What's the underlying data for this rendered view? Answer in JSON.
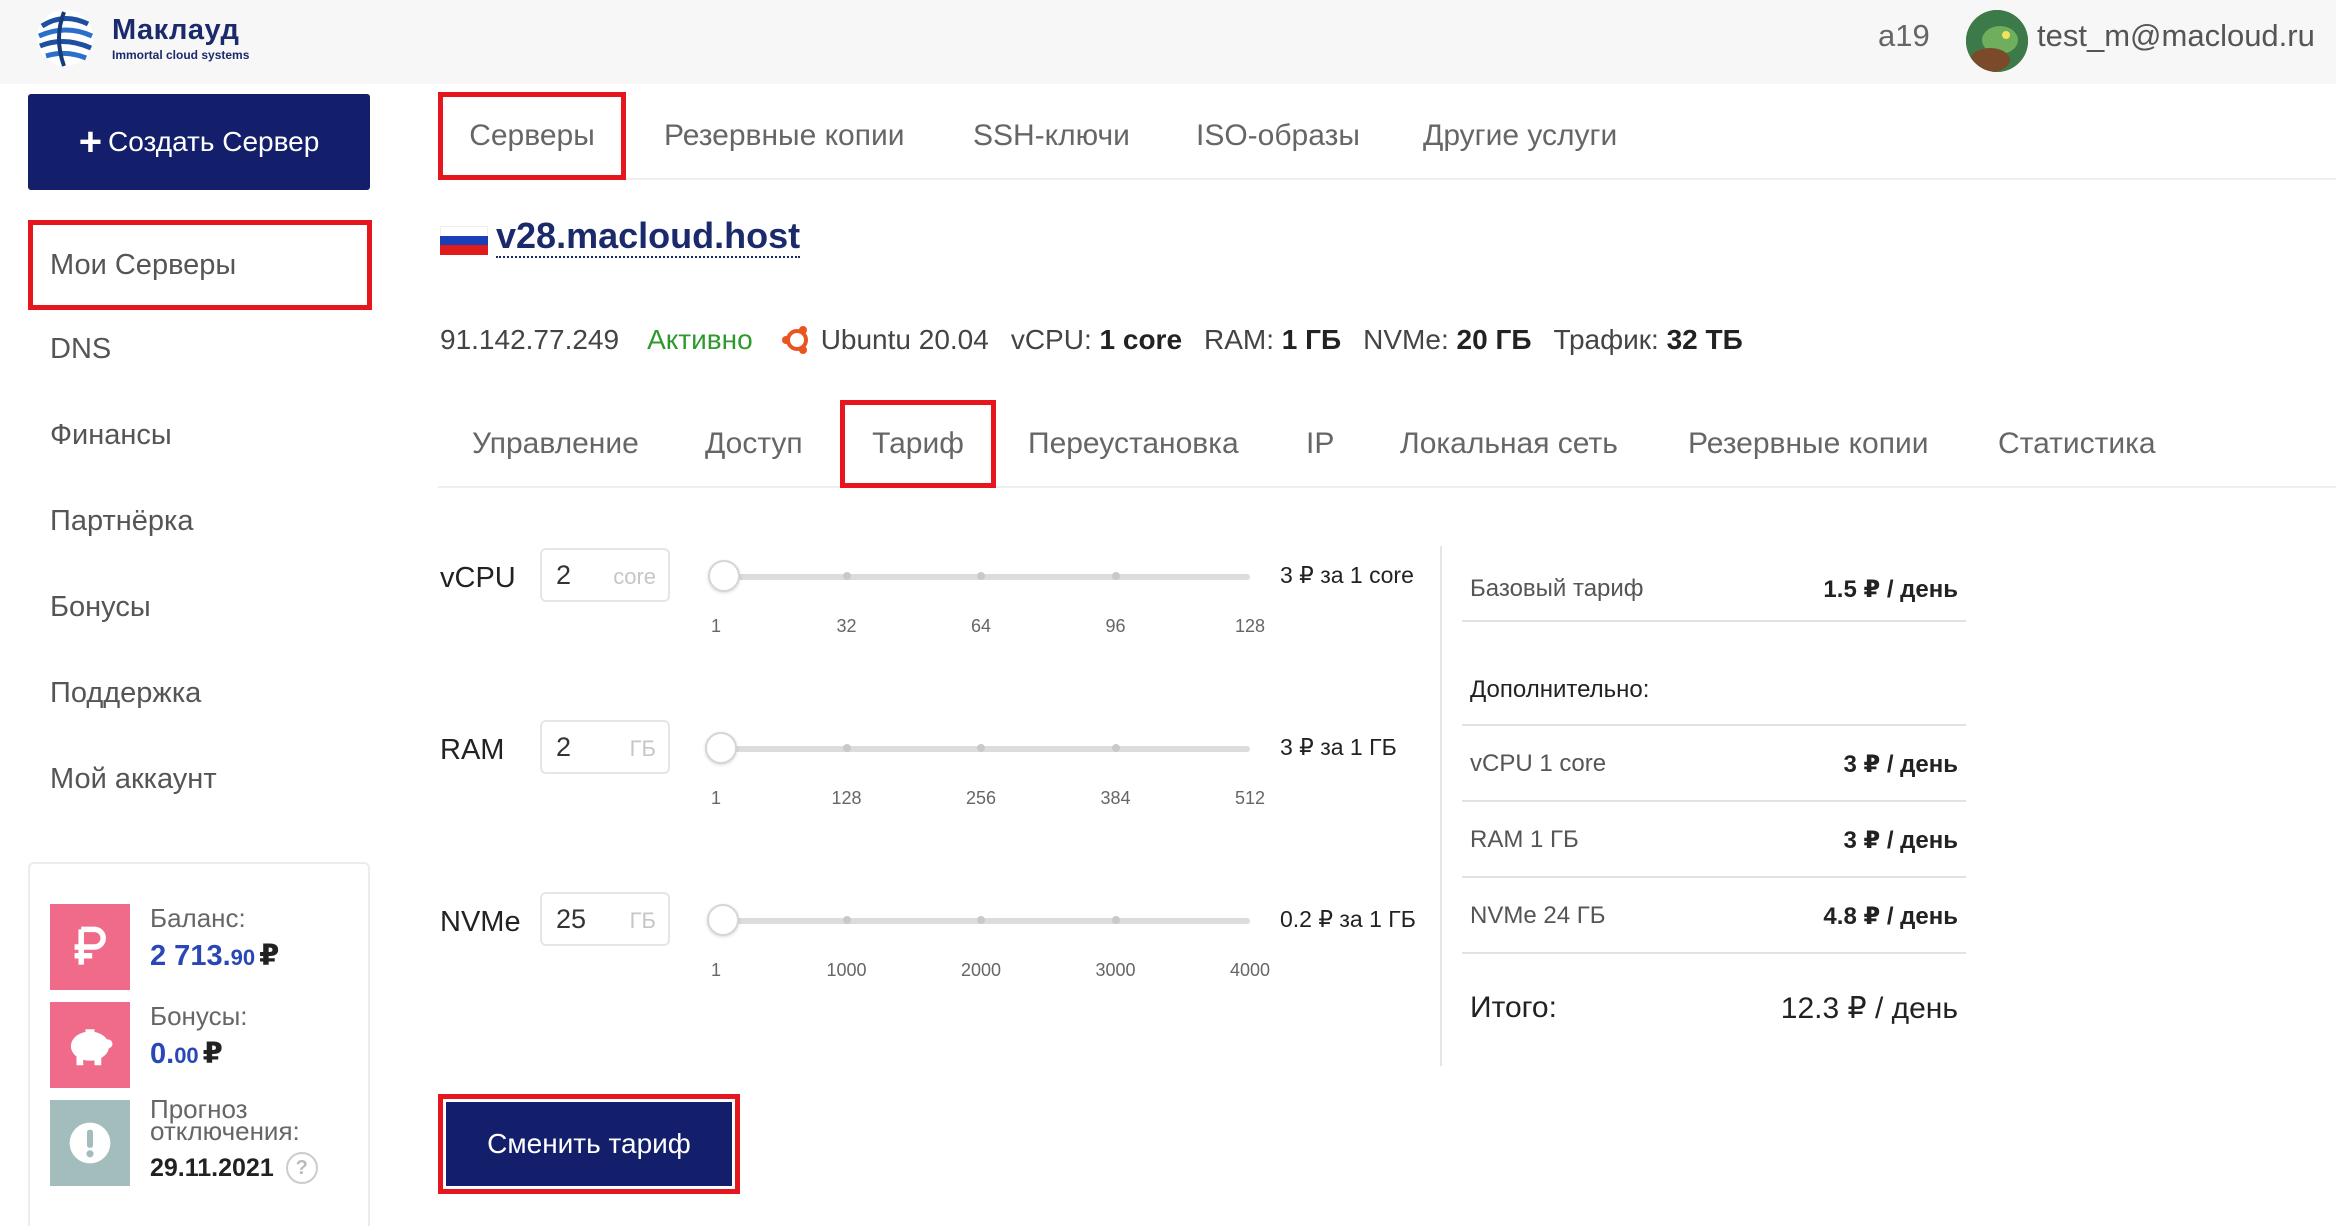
{
  "brand": {
    "name": "Маклауд",
    "tagline": "Immortal cloud systems"
  },
  "header": {
    "account_id": "a19",
    "user_email": "test_m@macloud.ru"
  },
  "sidebar": {
    "create_button": "Создать Сервер",
    "items": [
      {
        "label": "Мои Серверы"
      },
      {
        "label": "DNS"
      },
      {
        "label": "Финансы"
      },
      {
        "label": "Партнёрка"
      },
      {
        "label": "Бонусы"
      },
      {
        "label": "Поддержка"
      },
      {
        "label": "Мой аккаунт"
      }
    ]
  },
  "balance": {
    "balance_label": "Баланс:",
    "balance_int": "2 713.",
    "balance_dec": "90",
    "bonus_label": "Бонусы:",
    "bonus_int": "0.",
    "bonus_dec": "00",
    "currency": "₽",
    "forecast_label_1": "Прогноз",
    "forecast_label_2": "отключения:",
    "forecast_date": "29.11.2021",
    "help": "?"
  },
  "top_tabs": [
    {
      "label": "Серверы"
    },
    {
      "label": "Резервные копии"
    },
    {
      "label": "SSH-ключи"
    },
    {
      "label": "ISO-образы"
    },
    {
      "label": "Другие услуги"
    }
  ],
  "server": {
    "host": "v28.macloud.host",
    "ip": "91.142.77.249",
    "status": "Активно",
    "os": "Ubuntu 20.04",
    "vcpu_label": "vCPU:",
    "vcpu_value": "1 core",
    "ram_label": "RAM:",
    "ram_value": "1 ГБ",
    "nvme_label": "NVMe:",
    "nvme_value": "20 ГБ",
    "traffic_label": "Трафик:",
    "traffic_value": "32 ТБ",
    "status_color": "#2e9a2e"
  },
  "sub_tabs": [
    {
      "label": "Управление"
    },
    {
      "label": "Доступ"
    },
    {
      "label": "Тариф"
    },
    {
      "label": "Переустановка"
    },
    {
      "label": "IP"
    },
    {
      "label": "Локальная сеть"
    },
    {
      "label": "Резервные копии"
    },
    {
      "label": "Статистика"
    }
  ],
  "tariff": {
    "vcpu": {
      "label": "vCPU",
      "value": "2",
      "unit": "core",
      "min": 1,
      "max": 128,
      "current": 2,
      "ticks": [
        "1",
        "32",
        "64",
        "96",
        "128"
      ],
      "price": "3 ₽ за 1 core"
    },
    "ram": {
      "label": "RAM",
      "value": "2",
      "unit": "ГБ",
      "min": 1,
      "max": 512,
      "current": 2,
      "ticks": [
        "1",
        "128",
        "256",
        "384",
        "512"
      ],
      "price": "3 ₽ за 1 ГБ"
    },
    "nvme": {
      "label": "NVMe",
      "value": "25",
      "unit": "ГБ",
      "min": 1,
      "max": 4000,
      "current": 25,
      "ticks": [
        "1",
        "1000",
        "2000",
        "3000",
        "4000"
      ],
      "price": "0.2 ₽ за 1 ГБ"
    }
  },
  "summary": {
    "base_label": "Базовый тариф",
    "base_value": "1.5 ₽ / день",
    "extra_label": "Дополнительно:",
    "extras": [
      {
        "label": "vCPU 1 core",
        "value": "3 ₽ / день"
      },
      {
        "label": "RAM 1 ГБ",
        "value": "3 ₽ / день"
      },
      {
        "label": "NVMe 24 ГБ",
        "value": "4.8 ₽ / день"
      }
    ],
    "total_label": "Итого:",
    "total_value": "12.3 ₽ / день"
  },
  "actions": {
    "change_plan": "Сменить тариф"
  },
  "colors": {
    "primary": "#131f6b",
    "highlight": "#e5161e",
    "balance_pink": "#f06a8a",
    "forecast_gray": "#a3bcbc"
  }
}
